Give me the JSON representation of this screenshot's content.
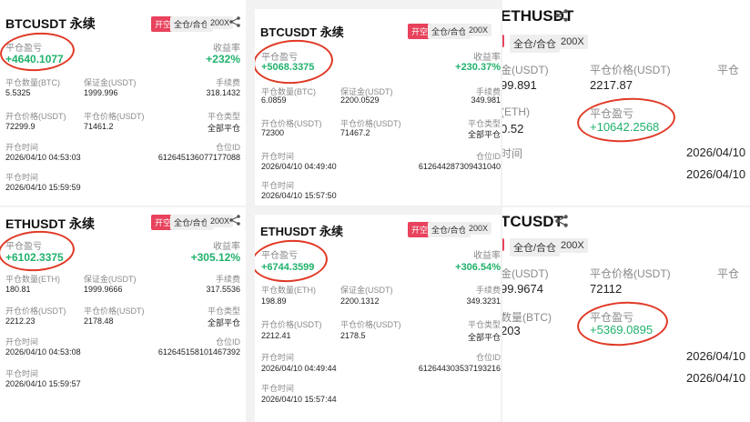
{
  "panel_btc_a": {
    "symbol": "BTCUSDT 永续",
    "open_tag": "开空",
    "margin_mode": "全仓/合仓",
    "leverage": "200X",
    "pnl_label": "平仓盈亏",
    "pnl_value": "+4640.1077",
    "roi_label": "收益率",
    "roi_value": "+232%",
    "qty_label": "平仓数量(BTC)",
    "qty_value": "5.5325",
    "margin_label": "保证金(USDT)",
    "margin_value": "1999.996",
    "fee_label": "手续费",
    "fee_value": "318.1432",
    "open_price_label": "开仓价格(USDT)",
    "open_price_value": "72299.9",
    "close_price_label": "平仓价格(USDT)",
    "close_price_value": "71461.2",
    "close_type_label": "平仓类型",
    "close_type_value": "全部平仓",
    "open_time_label": "开仓时间",
    "open_time_value": "2026/04/10 04:53:03",
    "position_id_label": "仓位ID",
    "position_id_value": "612645136077177088",
    "close_time_label": "平仓时间",
    "close_time_value": "2026/04/10 15:59:59"
  },
  "panel_btc_b": {
    "symbol": "BTCUSDT 永续",
    "open_tag": "开空",
    "margin_mode": "全仓/合仓",
    "leverage": "200X",
    "pnl_label": "平仓盈亏",
    "pnl_value": "+5068.3375",
    "roi_label": "收益率",
    "roi_value": "+230.37%",
    "qty_label": "平仓数量(BTC)",
    "qty_value": "6.0859",
    "margin_label": "保证金(USDT)",
    "margin_value": "2200.0529",
    "fee_label": "手续费",
    "fee_value": "349.981",
    "open_price_label": "开仓价格(USDT)",
    "open_price_value": "72300",
    "close_price_label": "平仓价格(USDT)",
    "close_price_value": "71467.2",
    "close_type_label": "平仓类型",
    "close_type_value": "全部平仓",
    "open_time_label": "开仓时间",
    "open_time_value": "2026/04/10 04:49:40",
    "position_id_label": "仓位ID",
    "position_id_value": "612644287309431040",
    "close_time_label": "平仓时间",
    "close_time_value": "2026/04/10 15:57:50"
  },
  "panel_eth_top_crop": {
    "symbol": "ETHUSDT",
    "margin_mode": "全仓/合仓",
    "leverage": "200X",
    "margin_label": "金(USDT)",
    "margin_value": "99.891",
    "close_price_label": "平仓价格(USDT)",
    "close_price_value": "2217.87",
    "edge_label": "平仓",
    "qty_label": "(ETH)",
    "qty_value": "0.52",
    "pnl_label": "平仓盈亏",
    "pnl_value": "+10642.2568",
    "time_label": "时间",
    "time_value": "2026/04/10",
    "time2_value": "2026/04/10"
  },
  "panel_eth_a": {
    "symbol": "ETHUSDT 永续",
    "open_tag": "开空",
    "margin_mode": "全仓/合仓",
    "leverage": "200X",
    "pnl_label": "平仓盈亏",
    "pnl_value": "+6102.3375",
    "roi_label": "收益率",
    "roi_value": "+305.12%",
    "qty_label": "平仓数量(ETH)",
    "qty_value": "180.81",
    "margin_label": "保证金(USDT)",
    "margin_value": "1999.9666",
    "fee_label": "手续费",
    "fee_value": "317.5536",
    "open_price_label": "开仓价格(USDT)",
    "open_price_value": "2212.23",
    "close_price_label": "平仓价格(USDT)",
    "close_price_value": "2178.48",
    "close_type_label": "平仓类型",
    "close_type_value": "全部平仓",
    "open_time_label": "开仓时间",
    "open_time_value": "2026/04/10 04:53:08",
    "position_id_label": "仓位ID",
    "position_id_value": "612645158101467392",
    "close_time_label": "平仓时间",
    "close_time_value": "2026/04/10 15:59:57"
  },
  "panel_eth_b": {
    "symbol": "ETHUSDT 永续",
    "open_tag": "开空",
    "margin_mode": "全仓/合仓",
    "leverage": "200X",
    "pnl_label": "平仓盈亏",
    "pnl_value": "+6744.3599",
    "roi_label": "收益率",
    "roi_value": "+306.54%",
    "qty_label": "平仓数量(ETH)",
    "qty_value": "198.89",
    "margin_label": "保证金(USDT)",
    "margin_value": "2200.1312",
    "fee_label": "手续费",
    "fee_value": "349.3231",
    "open_price_label": "开仓价格(USDT)",
    "open_price_value": "2212.41",
    "close_price_label": "平仓价格(USDT)",
    "close_price_value": "2178.5",
    "close_type_label": "平仓类型",
    "close_type_value": "全部平仓",
    "open_time_label": "开仓时间",
    "open_time_value": "2026/04/10 04:49:44",
    "position_id_label": "仓位ID",
    "position_id_value": "612644303537193216",
    "close_time_label": "平仓时间",
    "close_time_value": "2026/04/10 15:57:44"
  },
  "panel_btc_bottom_crop": {
    "symbol": "TCUSDT",
    "margin_mode": "全仓/合仓",
    "leverage": "200X",
    "margin_label": "金(USDT)",
    "margin_value": "99.9674",
    "close_price_label": "平仓价格(USDT)",
    "close_price_value": "72112",
    "edge_label": "平仓",
    "qty_label": "数量(BTC)",
    "qty_value": "203",
    "pnl_label": "平仓盈亏",
    "pnl_value": "+5369.0895",
    "time_value": "2026/04/10",
    "time2_value": "2026/04/10"
  },
  "colors": {
    "profit": "#20b26c",
    "open_tag": "#e8425c",
    "highlight_ring": "#e03a26"
  }
}
